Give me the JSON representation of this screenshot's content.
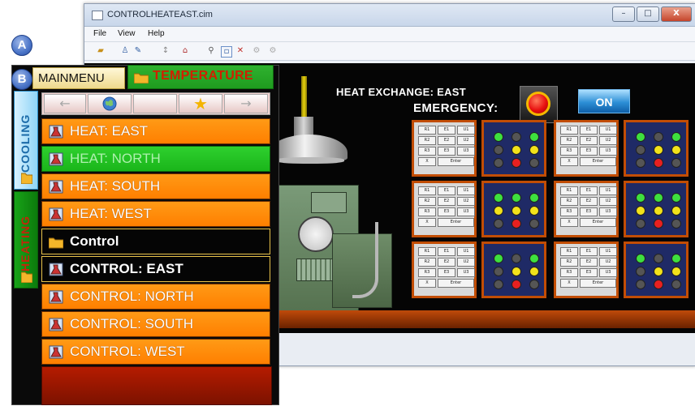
{
  "window": {
    "title": "CONTROLHEATEAST.cim",
    "controls": {
      "minimize": "–",
      "maximize": "□",
      "close": "X"
    },
    "menu": [
      "File",
      "View",
      "Help"
    ],
    "toolbar_icons": [
      "open-folder-icon",
      "user-icon",
      "info-icon",
      "arrow-icon",
      "home-icon",
      "zoom-icon",
      "select-icon",
      "delete-icon",
      "gear-icon",
      "settings-icon"
    ]
  },
  "scene": {
    "heat_exchange_label": "HEAT EXCHANGE: EAST",
    "emergency_label": "EMERGENCY:",
    "on_button": "ON",
    "keypad_keys": [
      "R1",
      "E1",
      "U1",
      "R2",
      "E2",
      "U2",
      "R3",
      "E3",
      "U3",
      "X",
      "Enter"
    ],
    "colors": {
      "background": "#050505",
      "floor": "#c04a0a",
      "panel_border": "#c24d05"
    }
  },
  "callouts": {
    "a": "A",
    "b": "B"
  },
  "menu_panel": {
    "mainmenu_tab": "MAINMENU",
    "temperature_tab": "TEMPERATURE",
    "cooling_tab": "COOLING",
    "heating_tab": "HEATING",
    "nav": {
      "back": "←",
      "globe": "globe-icon",
      "star": "★",
      "forward": "→"
    },
    "items": [
      {
        "label": "HEAT: EAST",
        "style": "orange",
        "icon": "flask-icon"
      },
      {
        "label": "HEAT: NORTH",
        "style": "green",
        "icon": "flask-icon"
      },
      {
        "label": "HEAT: SOUTH",
        "style": "orange",
        "icon": "flask-icon"
      },
      {
        "label": "HEAT: WEST",
        "style": "orange",
        "icon": "flask-icon"
      },
      {
        "label": "Control",
        "style": "black",
        "icon": "folder-icon"
      },
      {
        "label": "CONTROL: EAST",
        "style": "black",
        "icon": "flask-icon"
      },
      {
        "label": "CONTROL: NORTH",
        "style": "orange",
        "icon": "flask-icon"
      },
      {
        "label": "CONTROL: SOUTH",
        "style": "orange",
        "icon": "flask-icon"
      },
      {
        "label": "CONTROL: WEST",
        "style": "orange",
        "icon": "flask-icon"
      }
    ],
    "colors": {
      "orange": "#ff8a00",
      "green": "#22c422",
      "black": "#050505",
      "red_footer": "#a01800"
    }
  }
}
